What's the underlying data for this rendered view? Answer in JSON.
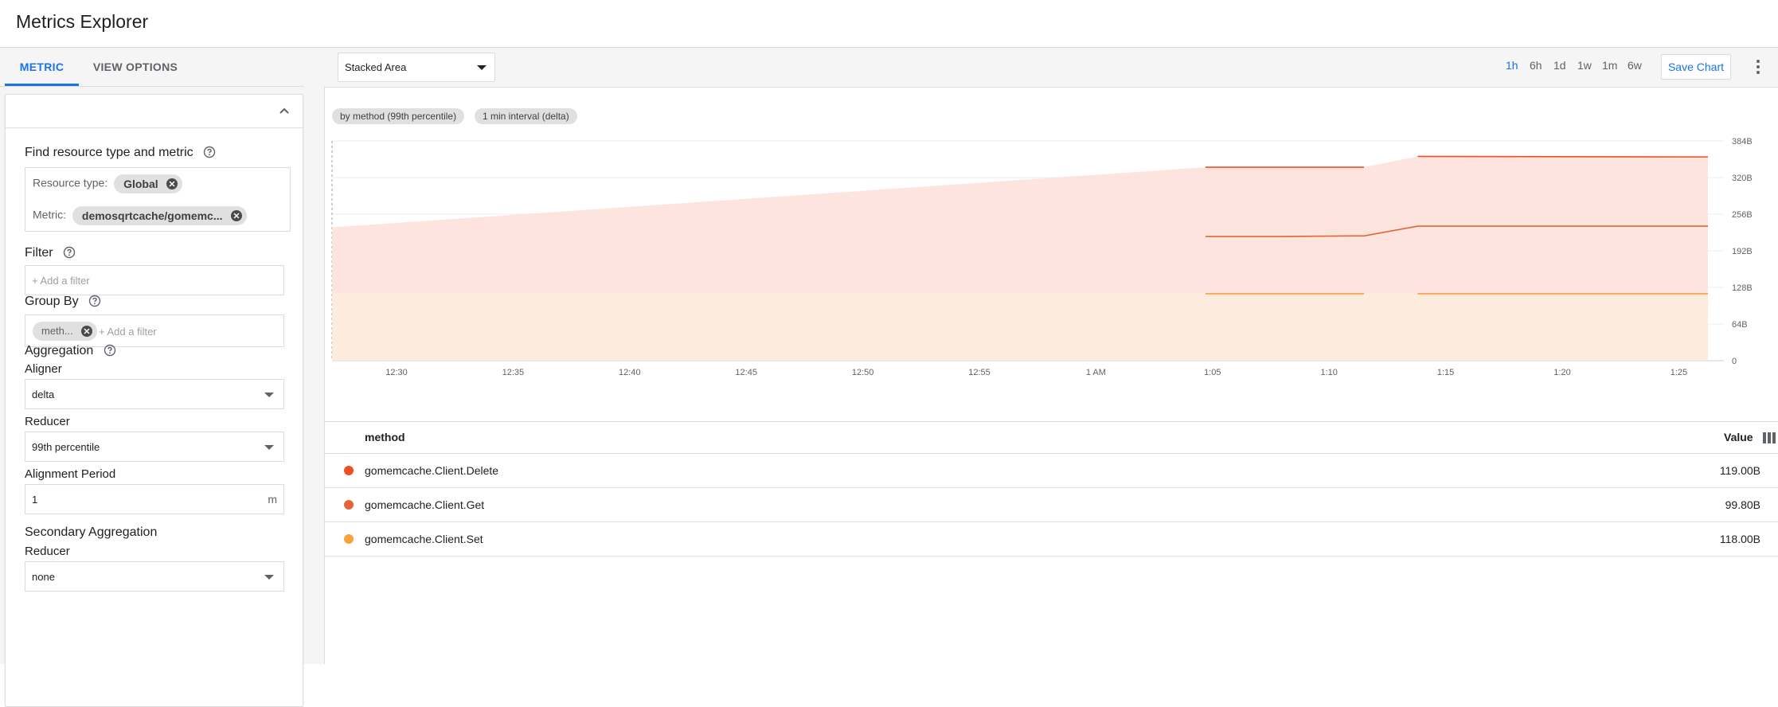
{
  "app": {
    "title": "Metrics Explorer"
  },
  "left": {
    "tabs": [
      {
        "label": "METRIC",
        "active": true
      },
      {
        "label": "VIEW OPTIONS",
        "active": false
      }
    ],
    "find_title": "Find resource type and metric",
    "resource_type_label": "Resource type:",
    "resource_type_value": "Global",
    "metric_label": "Metric:",
    "metric_value": "demosqrtcache/gomemc...",
    "filter_title": "Filter",
    "filter_placeholder": "+ Add a filter",
    "group_by_title": "Group By",
    "group_by_chip": "meth...",
    "group_by_placeholder": "+ Add a filter",
    "aggregation_title": "Aggregation",
    "aligner_label": "Aligner",
    "aligner_value": "delta",
    "reducer_label": "Reducer",
    "reducer_value": "99th percentile",
    "alignment_period_label": "Alignment Period",
    "alignment_period_value": "1",
    "alignment_period_unit": "m",
    "secondary_title": "Secondary Aggregation",
    "secondary_reducer_label": "Reducer",
    "secondary_reducer_value": "none"
  },
  "toolbar": {
    "chart_type": "Stacked Area",
    "ranges": [
      {
        "label": "1h",
        "active": true
      },
      {
        "label": "6h",
        "active": false
      },
      {
        "label": "1d",
        "active": false
      },
      {
        "label": "1w",
        "active": false
      },
      {
        "label": "1m",
        "active": false
      },
      {
        "label": "6w",
        "active": false
      }
    ],
    "save_label": "Save Chart",
    "more_icon": "more-vert-icon"
  },
  "chips": [
    "by method (99th percentile)",
    "1 min interval (delta)"
  ],
  "chart_data": {
    "type": "area",
    "stacked": true,
    "x_tick_labels": [
      "12:30",
      "12:35",
      "12:40",
      "12:45",
      "12:50",
      "12:55",
      "1 AM",
      "1:05",
      "1:10",
      "1:15",
      "1:20",
      "1:25"
    ],
    "y_tick_labels": [
      "0",
      "64B",
      "128B",
      "192B",
      "256B",
      "320B",
      "384B"
    ],
    "ylim": [
      0,
      384
    ],
    "grid": true,
    "series": [
      {
        "name": "gomemcache.Client.Set",
        "color": "#f9a03f",
        "points": [
          [
            12.45,
            118
          ],
          [
            61.5,
            118
          ],
          [
            61.6,
            118
          ],
          [
            61.75,
            118
          ],
          [
            63,
            118
          ],
          [
            65.2,
            118
          ],
          [
            65.3,
            118
          ],
          [
            66.4,
            118
          ],
          [
            67.3,
            118
          ]
        ]
      },
      {
        "name": "gomemcache.Client.Get",
        "color": "#e4643a",
        "points": [
          [
            12.45,
            0
          ],
          [
            61.5,
            0
          ],
          [
            61.6,
            100
          ],
          [
            61.75,
            100
          ],
          [
            63,
            100
          ],
          [
            65.2,
            100
          ],
          [
            65.3,
            100
          ],
          [
            66.4,
            118
          ],
          [
            67.3,
            118
          ]
        ]
      },
      {
        "name": "gomemcache.Client.Delete",
        "color": "#f04f24",
        "points": [
          [
            12.45,
            0
          ],
          [
            61.5,
            0
          ],
          [
            61.6,
            120
          ],
          [
            61.75,
            120
          ],
          [
            63,
            120
          ],
          [
            65.2,
            120
          ],
          [
            65.3,
            120
          ],
          [
            66.4,
            117
          ],
          [
            67.3,
            117
          ]
        ]
      }
    ],
    "dates_note": ""
  },
  "table": {
    "col_method": "method",
    "col_value": "Value",
    "rows": [
      {
        "name": "gomemcache.Client.Delete",
        "value": "119.00B",
        "color": "#f04f24"
      },
      {
        "name": "gomemcache.Client.Get",
        "value": "99.80B",
        "color": "#e4643a"
      },
      {
        "name": "gomemcache.Client.Set",
        "value": "118.00B",
        "color": "#f9a03f"
      }
    ]
  }
}
